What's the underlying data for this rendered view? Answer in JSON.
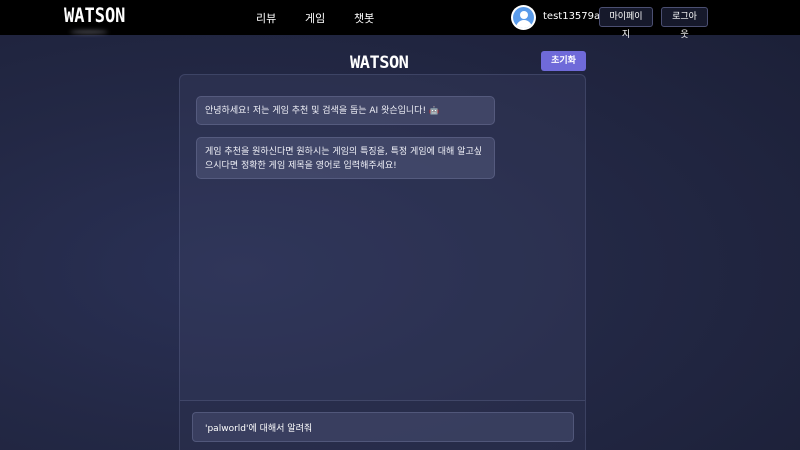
{
  "header": {
    "logo": "WATSON",
    "nav": [
      "리뷰",
      "게임",
      "챗봇"
    ],
    "username": "test13579a",
    "mypage_label": "마이페이지",
    "logout_label": "로그아웃"
  },
  "chat": {
    "title": "WATSON",
    "reset_label": "초기화",
    "messages": [
      {
        "role": "bot",
        "text": "안녕하세요! 저는 게임 추천 및 검색을 돕는 AI 왓슨입니다!",
        "emoji": "🤖"
      },
      {
        "role": "bot",
        "text": "게임 추천을 원하신다면 원하시는 게임의 특징을, 특정 게임에 대해 알고싶으시다면 정확한 게임 제목을 영어로 입력해주세요!"
      }
    ],
    "input_value": "'palworld'에 대해서 알려줘"
  },
  "colors": {
    "topbar": "#000000",
    "accent": "#6f6ad9",
    "background": "#232845"
  }
}
